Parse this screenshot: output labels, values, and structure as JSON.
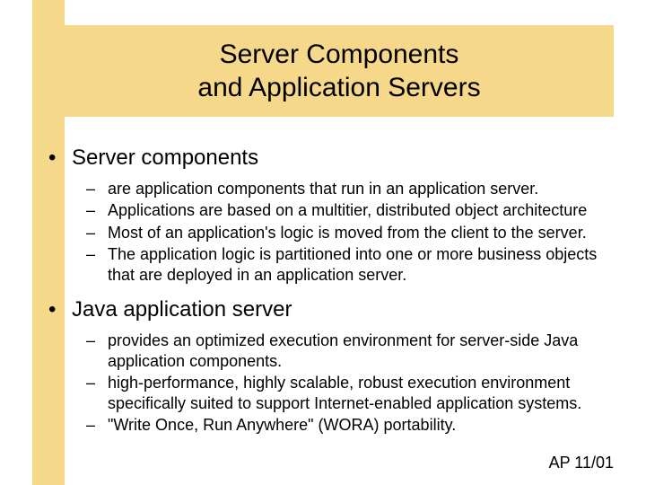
{
  "title": {
    "line1": "Server Components",
    "line2": "and Application Servers"
  },
  "bullets": [
    {
      "label": "Server components",
      "subs": [
        "are application components that run in an application server.",
        "Applications are based on a multitier, distributed object architecture",
        "Most of an application's logic is moved from the client to the server.",
        "The application logic is partitioned into one or more business objects that are deployed in an application server."
      ]
    },
    {
      "label": "Java application server",
      "subs": [
        "provides an optimized execution environment for server-side Java application components.",
        "high-performance, highly scalable, robust execution environment specifically suited to support Internet-enabled application systems.",
        "\"Write Once, Run Anywhere\" (WORA) portability."
      ]
    }
  ],
  "footer": "AP 11/01"
}
